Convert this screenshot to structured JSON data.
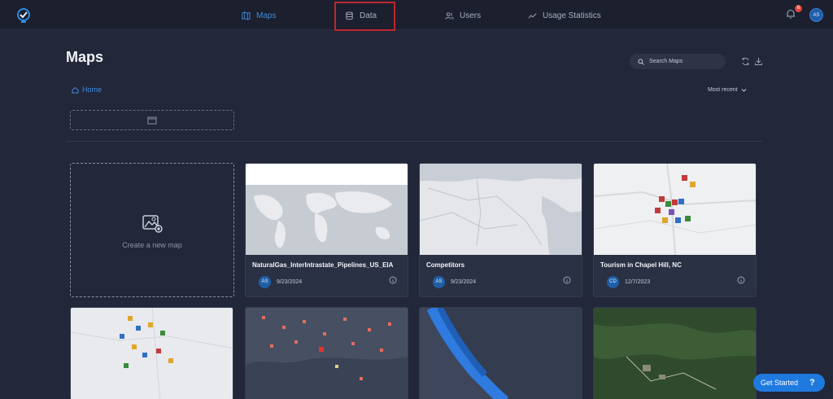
{
  "nav": {
    "items": [
      {
        "label": "Maps",
        "icon": "map-icon"
      },
      {
        "label": "Data",
        "icon": "database-icon"
      },
      {
        "label": "Users",
        "icon": "users-icon"
      },
      {
        "label": "Usage Statistics",
        "icon": "chart-line-icon"
      }
    ],
    "active": "Maps",
    "notification_count": "6",
    "user_initials": "AS"
  },
  "page": {
    "title": "Maps",
    "search_placeholder": "Search Maps",
    "breadcrumb": "Home",
    "sort_label": "Most recent",
    "create_label": "Create a new map"
  },
  "cards": [
    {
      "title": "NaturalGas_InterIntrastate_Pipelines_US_EIA",
      "initials": "AS",
      "date": "9/23/2024"
    },
    {
      "title": "Competitors",
      "initials": "AS",
      "date": "9/23/2024"
    },
    {
      "title": "Tourism in Chapel Hill, NC",
      "initials": "CD",
      "date": "12/7/2023"
    }
  ],
  "help": {
    "label": "Get Started",
    "icon": "?"
  },
  "colors": {
    "accent": "#3f8de0",
    "highlight": "#c0262d",
    "background": "#22273a"
  }
}
